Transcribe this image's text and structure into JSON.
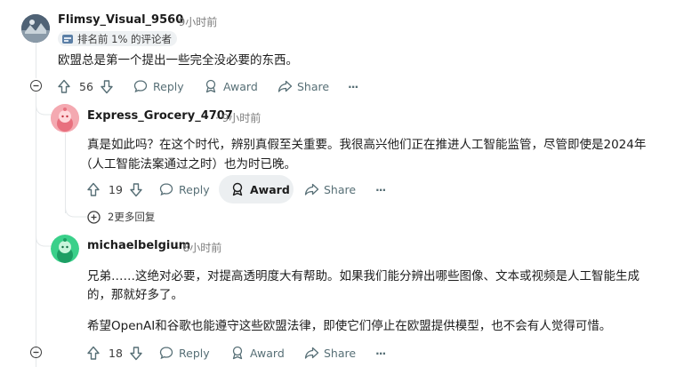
{
  "comments": [
    {
      "username": "Flimsy_Visual_9560",
      "time": "9小时前",
      "badge": "排名前 1% 的评论者",
      "text": "欧盟总是第一个提出一些完全没必要的东西。",
      "votes": "56",
      "actions": {
        "reply": "Reply",
        "award": "Award",
        "share": "Share",
        "more": "···"
      }
    },
    {
      "username": "Express_Grocery_4707",
      "time": "9小时前",
      "text_line1": "真是如此吗？在这个时代，辨别真假至关重要。我很高兴他们正在推进人工智能监管，尽管即使是2024年",
      "text_line2": "（人工智能法案通过之时）也为时已晚。",
      "votes": "19",
      "actions": {
        "reply": "Reply",
        "award": "Award",
        "share": "Share",
        "more": "···"
      },
      "more_replies": "2更多回复"
    },
    {
      "username": "michaelbelgium",
      "time": "8小时前",
      "para1_line1": "兄弟……这绝对必要，对提高透明度大有帮助。如果我们能分辨出哪些图像、文本或视频是人工智能生成",
      "para1_line2": "的，那就好多了。",
      "para2": "希望OpenAI和谷歌也能遵守这些欧盟法律，即使它们停止在欧盟提供模型，也不会有人觉得可惜。",
      "votes": "18",
      "actions": {
        "reply": "Reply",
        "award": "Award",
        "share": "Share",
        "more": "···"
      }
    }
  ],
  "separator": "·",
  "colors": {
    "background": "#ffffff",
    "meta": "#7c7c7c",
    "action": "#576f76",
    "thread": "#e5e8ea",
    "award_bg": "#eceff1"
  }
}
